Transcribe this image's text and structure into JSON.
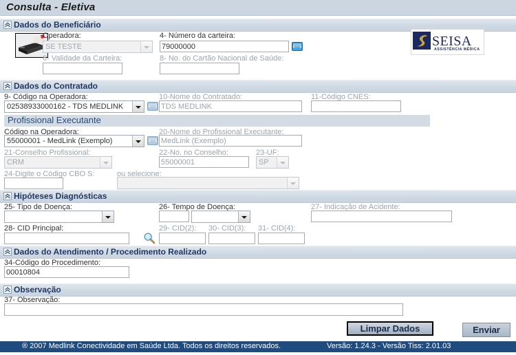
{
  "window": {
    "title": "Consulta - Eletiva"
  },
  "colors": {
    "band": "#cfd9e3",
    "header_text": "#1f3864",
    "footer_bg": "#1f4b7f",
    "title_bar": "#ccd6e0",
    "logo_navy": "#1b2a5e",
    "logo_gold": "#c7a24a"
  },
  "sections": {
    "beneficiary": {
      "title": "Dados do Beneficiário",
      "collapse_icon": "chevron-double-up-icon",
      "card_reader_icon": "card-reader-icon",
      "fields": {
        "operadora_label": "Operadora:",
        "operadora_value": "SE TESTE",
        "carteira_label": "4- Número da carteira:",
        "carteira_value": "79000000",
        "validade_label": "6- Validade da Carteira:",
        "validade_value": "",
        "cns_label": "8- No. do Cartão Nacional de Saúde:",
        "cns_value": ""
      },
      "logo": {
        "name": "SEISA",
        "subtitle": "ASSISTÊNCIA MÉDICA"
      }
    },
    "contracted": {
      "title": "Dados do Contratado",
      "collapse_icon": "chevron-double-up-icon",
      "fields": {
        "codigo_label": "9- Código na Operadora:",
        "codigo_value": "02538933000162 - TDS MEDLINK",
        "nome_label": "10-Nome do Contratado:",
        "nome_value": "TDS MEDLINK",
        "cnes_label": "11-Código CNES:",
        "cnes_value": ""
      },
      "professional": {
        "title": "Profissional Executante",
        "codigo_label": "Código na Operadora:",
        "codigo_value": "55000001 - MedLink (Exemplo)",
        "nome_label": "20-Nome do Profissional Executante:",
        "nome_value": "MedLink (Exemplo)",
        "conselho_label": "21-Conselho Profissional:",
        "conselho_value": "CRM",
        "numero_conselho_label": "22-No. no Conselho:",
        "numero_conselho_value": "55000001",
        "uf_label": "23-UF:",
        "uf_value": "SP",
        "cbo_label": "24-Digite o Código CBO S:",
        "cbo_value": "",
        "cbo_select_label": "ou selecione:",
        "cbo_select_value": ""
      }
    },
    "diagnostics": {
      "title": "Hipóteses Diagnósticas",
      "collapse_icon": "chevron-double-up-icon",
      "fields": {
        "tipo_doenca_label": "25- Tipo de Doença:",
        "tipo_doenca_value": "",
        "tempo_doenca_label": "26- Tempo de Doença:",
        "tempo_doenca_num": "",
        "tempo_doenca_unit": "",
        "acidente_label": "27- Indicação de Acidente:",
        "acidente_value": "",
        "cid_principal_label": "28- CID Principal:",
        "cid_principal_value": "",
        "search_icon": "magnifier-icon",
        "cid2_label": "29- CID(2):",
        "cid2_value": "",
        "cid3_label": "30- CID(3):",
        "cid3_value": "",
        "cid4_label": "31- CID(4):",
        "cid4_value": ""
      }
    },
    "attendance": {
      "title": "Dados do Atendimento / Procedimento Realizado",
      "collapse_icon": "chevron-double-up-icon",
      "fields": {
        "procedimento_label": "34-Código do Procedimento:",
        "procedimento_value": "00010804"
      }
    },
    "observation": {
      "title": "Observação",
      "collapse_icon": "chevron-double-up-icon",
      "fields": {
        "observacao_label": "37- Observação:",
        "observacao_value": ""
      }
    }
  },
  "actions": {
    "clear_label": "Limpar Dados",
    "submit_label": "Enviar"
  },
  "footer": {
    "copyright": "® 2007  Medlink Conectividade em Saúde Ltda.   Todos os direitos reservados.",
    "version": "Versão: 1.24.3 - Versão Tiss: 2.01.03"
  }
}
